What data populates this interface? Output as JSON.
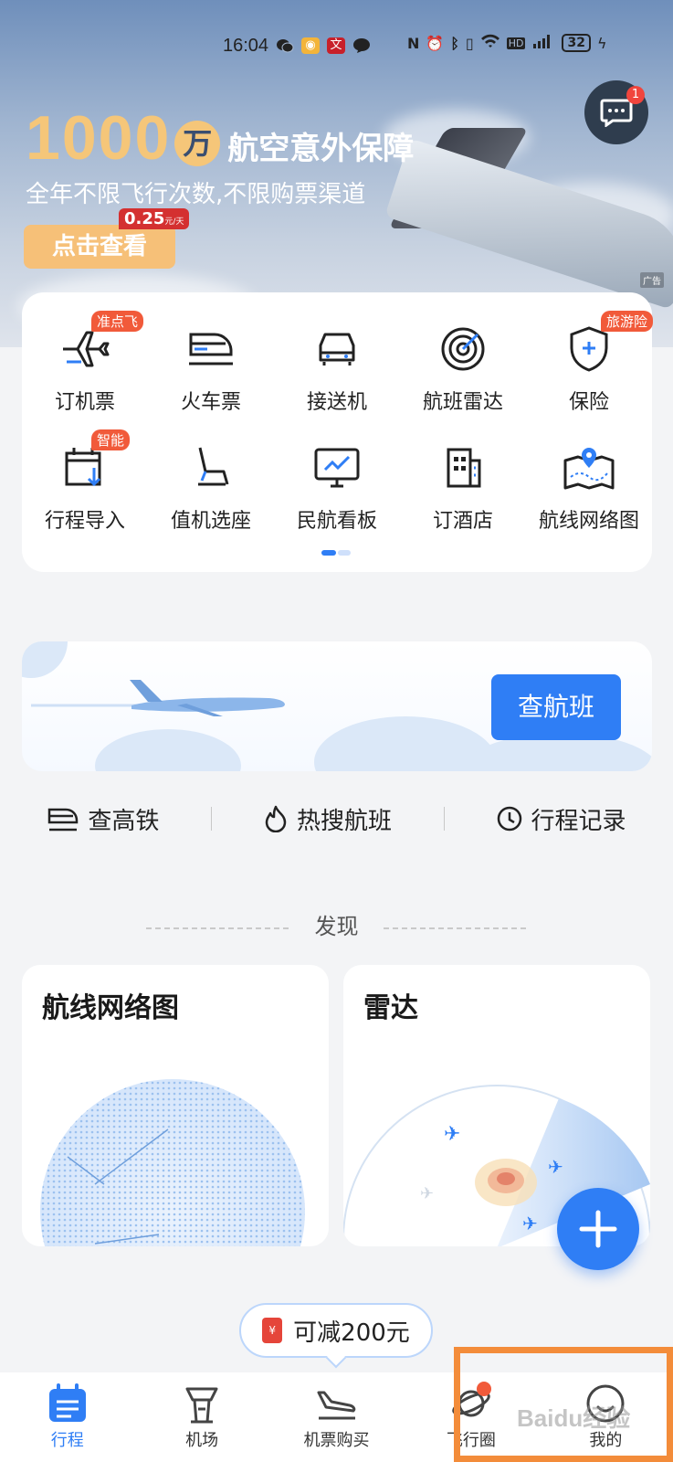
{
  "status_bar": {
    "time": "16:04",
    "battery": "32"
  },
  "banner": {
    "big_number": "1000",
    "unit": "万",
    "title": "航空意外保障",
    "subtitle": "全年不限飞行次数,不限购票渠道",
    "button": "点击查看",
    "price": "0.25",
    "price_unit": "元/天",
    "ad_tag": "广告",
    "message_badge": "1"
  },
  "grid": [
    {
      "label": "订机票",
      "badge": "准点飞",
      "icon": "airplane-icon"
    },
    {
      "label": "火车票",
      "badge": "",
      "icon": "train-icon"
    },
    {
      "label": "接送机",
      "badge": "",
      "icon": "car-icon"
    },
    {
      "label": "航班雷达",
      "badge": "",
      "icon": "radar-icon"
    },
    {
      "label": "保险",
      "badge": "旅游险",
      "icon": "shield-plus-icon"
    },
    {
      "label": "行程导入",
      "badge": "智能",
      "icon": "import-icon"
    },
    {
      "label": "值机选座",
      "badge": "",
      "icon": "seat-icon"
    },
    {
      "label": "民航看板",
      "badge": "",
      "icon": "dashboard-icon"
    },
    {
      "label": "订酒店",
      "badge": "",
      "icon": "hotel-icon"
    },
    {
      "label": "航线网络图",
      "badge": "",
      "icon": "route-map-icon"
    }
  ],
  "flight_search": {
    "button": "查航班"
  },
  "quick_links": [
    {
      "label": "查高铁",
      "icon": "train-icon"
    },
    {
      "label": "热搜航班",
      "icon": "fire-icon"
    },
    {
      "label": "行程记录",
      "icon": "clock-icon"
    }
  ],
  "discover": {
    "heading": "发现",
    "cards": [
      {
        "title": "航线网络图"
      },
      {
        "title": "雷达"
      }
    ]
  },
  "coupon": {
    "text": "可减200元",
    "icon_text": "¥"
  },
  "tabbar": [
    {
      "label": "行程",
      "icon": "itinerary-icon",
      "active": true
    },
    {
      "label": "机场",
      "icon": "airport-tower-icon",
      "active": false
    },
    {
      "label": "机票购买",
      "icon": "plane-landing-icon",
      "active": false
    },
    {
      "label": "飞行圈",
      "icon": "planet-icon",
      "active": false
    },
    {
      "label": "我的",
      "icon": "profile-icon",
      "active": false
    }
  ],
  "watermark": "Baidu经验",
  "colors": {
    "accent": "#2f7ef5",
    "badge": "#f15a3a",
    "gold": "#f5c679",
    "highlight": "#f38c3a"
  }
}
